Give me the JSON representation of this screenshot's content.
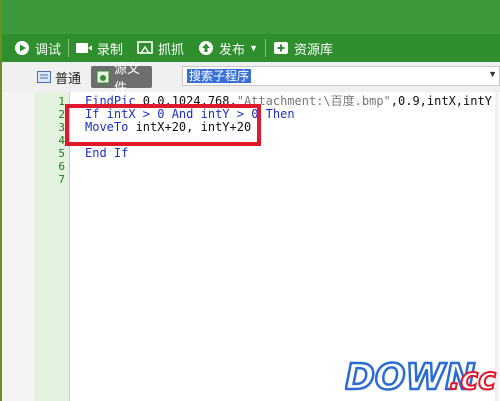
{
  "toolbar": {
    "debug_label": "调试",
    "record_label": "录制",
    "capture_label": "抓抓",
    "publish_label": "发布",
    "library_label": "资源库"
  },
  "tabs": {
    "normal_label": "普通",
    "source_label": "源文件"
  },
  "subroutine_select": {
    "value": "搜索子程序"
  },
  "editor": {
    "line_numbers": [
      "1",
      "2",
      "3",
      "4",
      "5",
      "6",
      "7"
    ],
    "lines": [
      {
        "kw": "FindPic",
        "rest": " 0,0,1024,768,",
        "str": "\"Attachment:\\百度.bmp\"",
        "tail": ",0.9,intX,intY"
      },
      {
        "kw": "If",
        "rest": " intX > 0 ",
        "kw2": "And",
        "rest2": " intY > 0 ",
        "kw3": "Then"
      },
      {
        "kw": "MoveTo",
        "rest": " intX+20, intY+20"
      },
      {},
      {
        "kw": "End If"
      },
      {},
      {}
    ]
  },
  "watermark": {
    "text": "DOWN.cc"
  },
  "colors": {
    "toolbar_green": "#2f8f2f",
    "highlight_red": "#e0182c",
    "keyword_blue": "#1a2fd0"
  }
}
